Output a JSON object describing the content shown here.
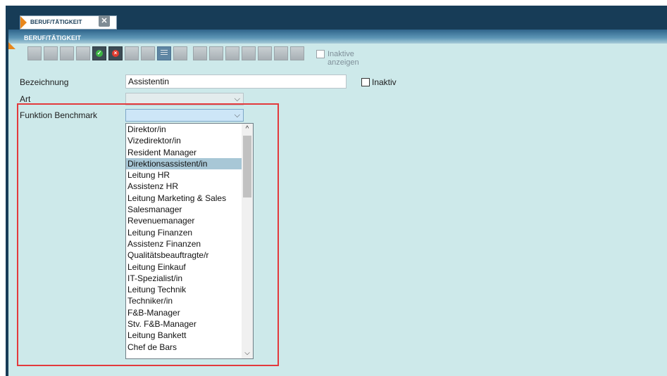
{
  "tab": {
    "label": "BERUF/TÄTIGKEIT"
  },
  "section": {
    "title": "BERUF/TÄTIGKEIT"
  },
  "toolbar": {
    "inactive_label": "Inaktive anzeigen"
  },
  "form": {
    "bezeichnung_label": "Bezeichnung",
    "bezeichnung_value": "Assistentin",
    "inaktiv_label": "Inaktiv",
    "art_label": "Art",
    "art_value": "",
    "funktion_label": "Funktion Benchmark",
    "funktion_value": ""
  },
  "dropdown": {
    "selected_index": 3,
    "items": [
      "Direktor/in",
      "Vizedirektor/in",
      "Resident Manager",
      "Direktionsassistent/in",
      "Leitung HR",
      "Assistenz HR",
      "Leitung Marketing & Sales",
      "Salesmanager",
      "Revenuemanager",
      "Leitung Finanzen",
      "Assistenz Finanzen",
      "Qualitätsbeauftragte/r",
      "Leitung Einkauf",
      "IT-Spezialist/in",
      "Leitung Technik",
      "Techniker/in",
      "F&B-Manager",
      "Stv. F&B-Manager",
      "Leitung Bankett",
      "Chef de Bars"
    ]
  },
  "colors": {
    "frame": "#173c57",
    "content_bg": "#cde9ea",
    "accent": "#e8871d",
    "highlight": "#e3393c",
    "selected_item": "#a8c7d6"
  }
}
